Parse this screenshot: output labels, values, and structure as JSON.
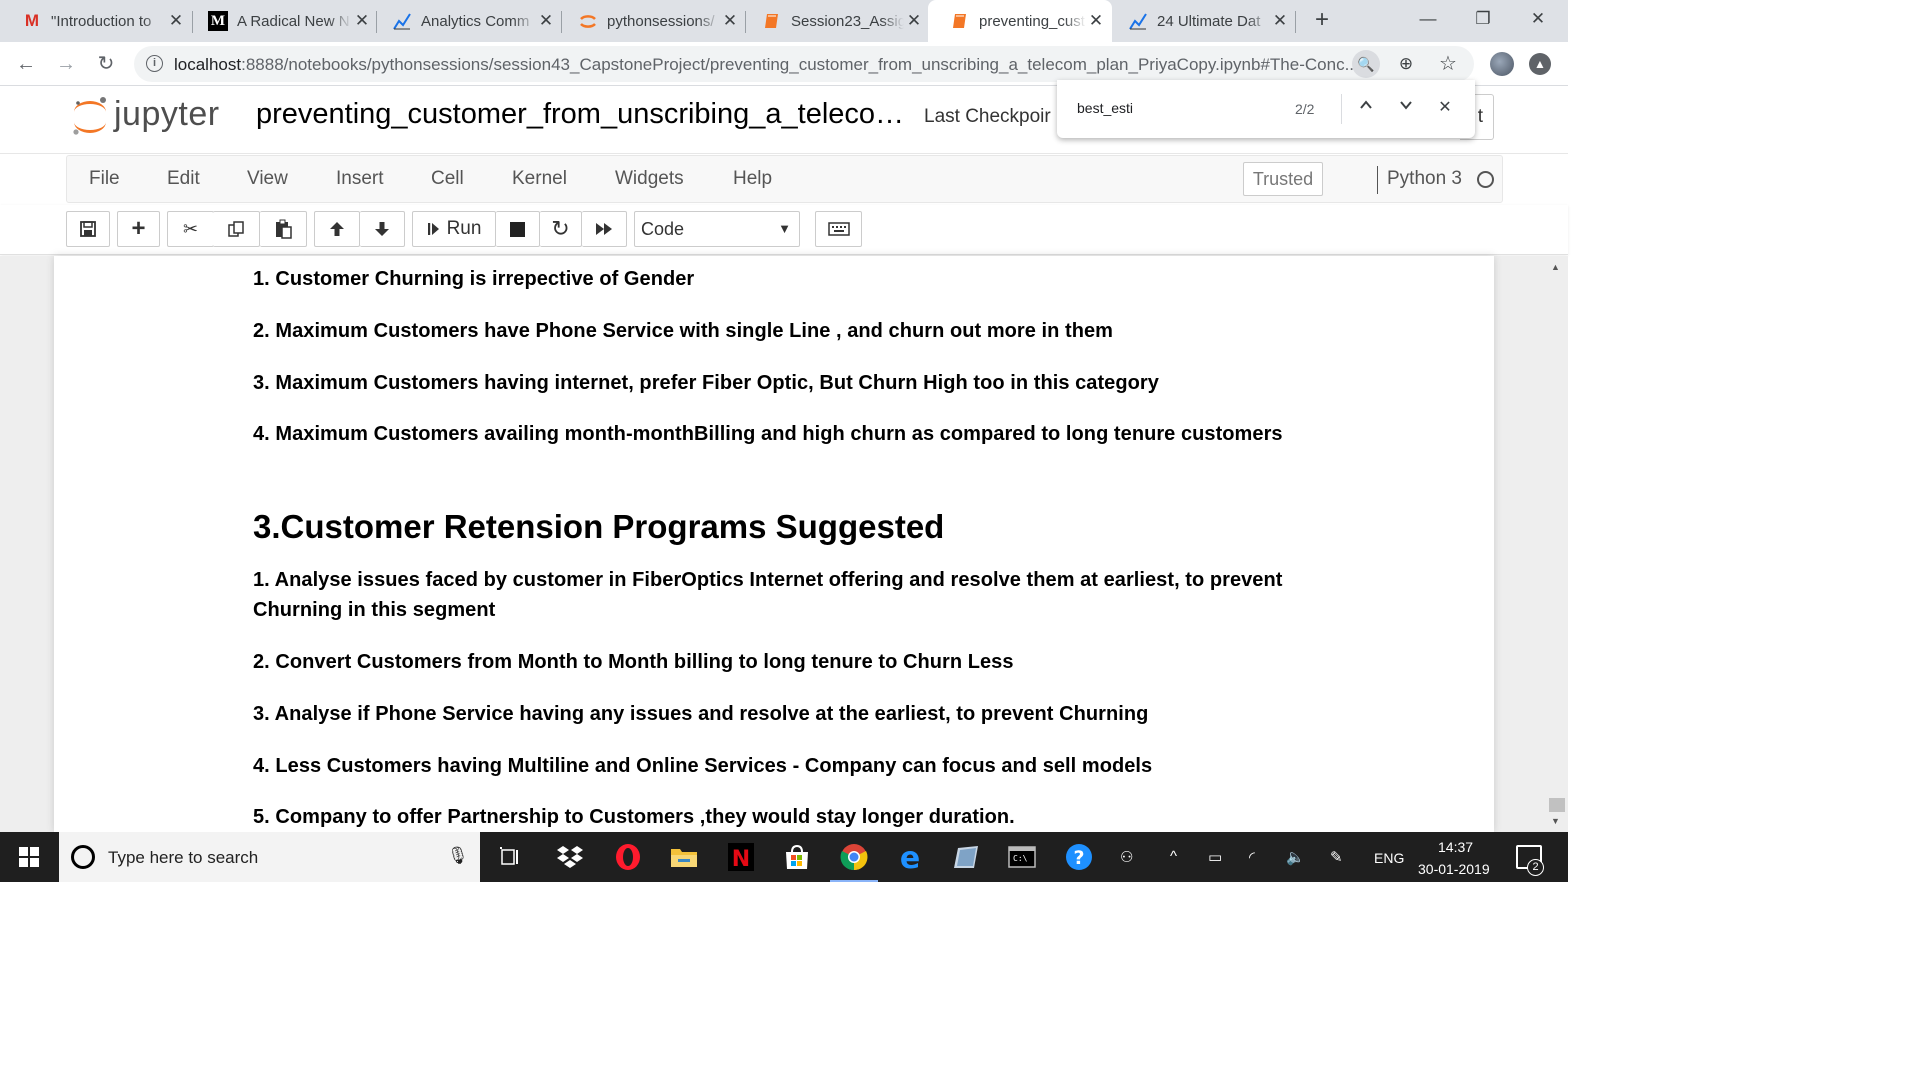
{
  "browser": {
    "tabs": [
      {
        "title": "\"Introduction to",
        "favicon": "gmail-icon",
        "active": false
      },
      {
        "title": "A Radical New N",
        "favicon": "medium-icon",
        "active": false
      },
      {
        "title": "Analytics Comm",
        "favicon": "analytics-vidhya-icon",
        "active": false
      },
      {
        "title": "pythonsessions/",
        "favicon": "jupyter-icon",
        "active": false
      },
      {
        "title": "Session23_Assig",
        "favicon": "notebook-icon",
        "active": false
      },
      {
        "title": "preventing_cust",
        "favicon": "notebook-icon",
        "active": true
      },
      {
        "title": "24 Ultimate Dat",
        "favicon": "analytics-vidhya-icon",
        "active": false
      }
    ],
    "url_host": "localhost",
    "url_rest": ":8888/notebooks/pythonsessions/session43_CapstoneProject/preventing_customer_from_unscribing_a_telecom_plan_PriyaCopy.ipynb#The-Conc...",
    "find": {
      "query": "best_esti",
      "count": "2/2"
    }
  },
  "jupyter": {
    "wordmark": "jupyter",
    "notebook_title": "preventing_customer_from_unscribing_a_teleco…",
    "checkpoint": "Last Checkpoir",
    "logout_edge": "t",
    "menu": [
      "File",
      "Edit",
      "View",
      "Insert",
      "Cell",
      "Kernel",
      "Widgets",
      "Help"
    ],
    "trusted": "Trusted",
    "kernel": "Python 3",
    "run_label": "Run",
    "cell_type": "Code"
  },
  "notebook": {
    "insights": [
      "1. Customer Churning is irrepective of Gender",
      "2. Maximum Customers have Phone Service with single Line , and churn out more in them",
      "3. Maximum Customers having internet, prefer Fiber Optic, But Churn High too in this category",
      "4. Maximum Customers availing month-monthBilling and high churn as compared to long tenure customers"
    ],
    "section_heading": "3.Customer Retension Programs Suggested",
    "programs": [
      "1. Analyse issues faced by customer in FiberOptics Internet offering and resolve them at earliest, to prevent",
      "Churning in this segment",
      "2. Convert Customers from Month to Month billing to long tenure to Churn Less",
      "3. Analyse if Phone Service having any issues and resolve at the earliest, to prevent Churning",
      "4. Less Customers having Multiline and Online Services - Company can focus and sell models",
      "5. Company to offer Partnership to Customers ,they would stay longer duration."
    ]
  },
  "taskbar": {
    "search_placeholder": "Type here to search",
    "language": "ENG",
    "time": "14:37",
    "date": "30-01-2019",
    "notification_count": "2"
  }
}
